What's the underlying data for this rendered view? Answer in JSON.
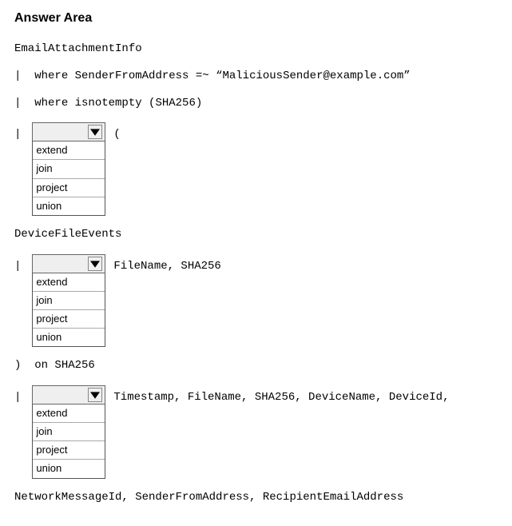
{
  "title": "Answer Area",
  "code": {
    "line1": "EmailAttachmentInfo",
    "pipe": "|",
    "line2_prefix": "where SenderFromAddress =~ ",
    "line2_quoted": "“MaliciousSender@example.com”",
    "line3": "where isnotempty (SHA256)",
    "dd1_after": "(",
    "line4": "DeviceFileEvents",
    "dd2_after": "FileName, SHA256",
    "line5_prefix": ")",
    "line5_rest": "on SHA256",
    "dd3_after": "Timestamp, FileName, SHA256, DeviceName, DeviceId,",
    "line6": "NetworkMessageId, SenderFromAddress, RecipientEmailAddress"
  },
  "dropdown_options": [
    "extend",
    "join",
    "project",
    "union"
  ]
}
